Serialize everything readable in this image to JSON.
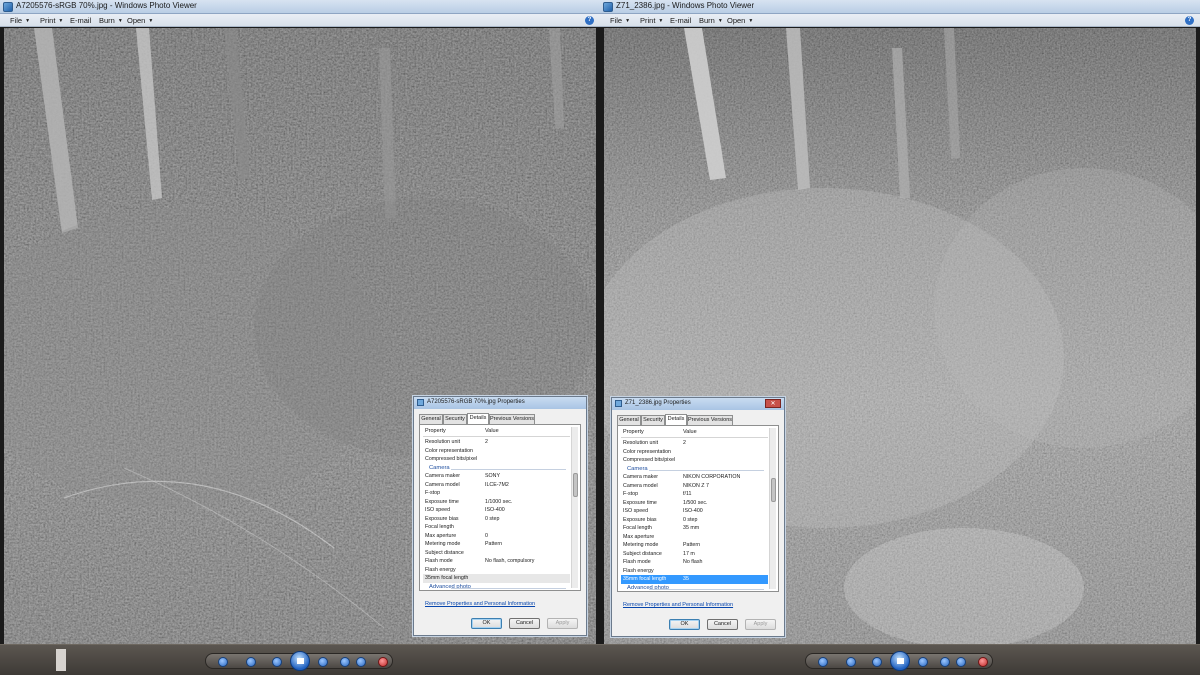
{
  "left": {
    "title": "A7205576-sRGB 70%.jpg - Windows Photo Viewer",
    "menu": [
      "File",
      "Print",
      "E-mail",
      "Burn",
      "Open"
    ],
    "dialog": {
      "title": "A7205576-sRGB 70%.jpg Properties",
      "tabs": [
        "General",
        "Security",
        "Details",
        "Previous Versions"
      ],
      "active_tab": "Details",
      "col_property": "Property",
      "col_value": "Value",
      "rows": [
        {
          "p": "Resolution unit",
          "v": "2",
          "kind": "partial"
        },
        {
          "p": "Color representation",
          "v": ""
        },
        {
          "p": "Compressed bits/pixel",
          "v": ""
        },
        {
          "p": "Camera",
          "v": "",
          "kind": "group"
        },
        {
          "p": "Camera maker",
          "v": "SONY"
        },
        {
          "p": "Camera model",
          "v": "ILCE-7M2"
        },
        {
          "p": "F-stop",
          "v": ""
        },
        {
          "p": "Exposure time",
          "v": "1/1000 sec."
        },
        {
          "p": "ISO speed",
          "v": "ISO-400"
        },
        {
          "p": "Exposure bias",
          "v": "0 step"
        },
        {
          "p": "Focal length",
          "v": ""
        },
        {
          "p": "Max aperture",
          "v": "0"
        },
        {
          "p": "Metering mode",
          "v": "Pattern"
        },
        {
          "p": "Subject distance",
          "v": ""
        },
        {
          "p": "Flash mode",
          "v": "No flash, compulsory"
        },
        {
          "p": "Flash energy",
          "v": ""
        },
        {
          "p": "35mm focal length",
          "v": "",
          "kind": "hl"
        },
        {
          "p": "Advanced photo",
          "v": "",
          "kind": "group"
        }
      ],
      "link": "Remove Properties and Personal Information",
      "ok": "OK",
      "cancel": "Cancel",
      "apply": "Apply"
    }
  },
  "right": {
    "title": "Z71_2386.jpg - Windows Photo Viewer",
    "menu": [
      "File",
      "Print",
      "E-mail",
      "Burn",
      "Open"
    ],
    "dialog": {
      "title": "Z71_2386.jpg Properties",
      "tabs": [
        "General",
        "Security",
        "Details",
        "Previous Versions"
      ],
      "active_tab": "Details",
      "col_property": "Property",
      "col_value": "Value",
      "rows": [
        {
          "p": "Resolution unit",
          "v": "2"
        },
        {
          "p": "Color representation",
          "v": ""
        },
        {
          "p": "Compressed bits/pixel",
          "v": ""
        },
        {
          "p": "Camera",
          "v": "",
          "kind": "group"
        },
        {
          "p": "Camera maker",
          "v": "NIKON CORPORATION"
        },
        {
          "p": "Camera model",
          "v": "NIKON Z 7"
        },
        {
          "p": "F-stop",
          "v": "f/11"
        },
        {
          "p": "Exposure time",
          "v": "1/500 sec."
        },
        {
          "p": "ISO speed",
          "v": "ISO-400"
        },
        {
          "p": "Exposure bias",
          "v": "0 step"
        },
        {
          "p": "Focal length",
          "v": "35 mm"
        },
        {
          "p": "Max aperture",
          "v": ""
        },
        {
          "p": "Metering mode",
          "v": "Pattern"
        },
        {
          "p": "Subject distance",
          "v": "17 m"
        },
        {
          "p": "Flash mode",
          "v": "No flash"
        },
        {
          "p": "Flash energy",
          "v": ""
        },
        {
          "p": "35mm focal length",
          "v": "35",
          "kind": "sel"
        },
        {
          "p": "Advanced photo",
          "v": "",
          "kind": "group"
        }
      ],
      "link": "Remove Properties and Personal Information",
      "ok": "OK",
      "cancel": "Cancel",
      "apply": "Apply"
    }
  },
  "colors": {
    "titlebar": "#c3d5ea",
    "selection": "#3399ff",
    "link": "#0645ad",
    "group_header": "#1f4fa0"
  },
  "icons": [
    "help-icon",
    "zoom-icon",
    "fit-icon",
    "previous-icon",
    "slideshow-icon",
    "next-icon",
    "rotate-left-icon",
    "rotate-right-icon",
    "delete-icon"
  ]
}
